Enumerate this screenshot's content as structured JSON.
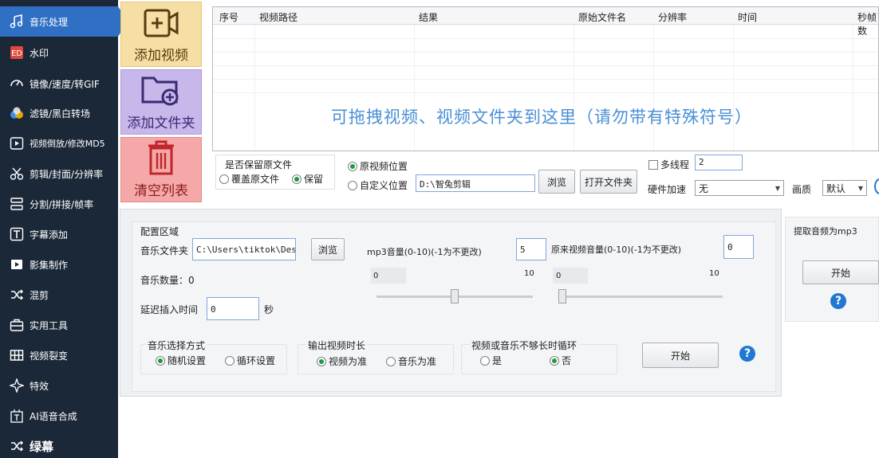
{
  "sidebar": {
    "items": [
      {
        "label": "音乐处理",
        "icon": "music-note-icon"
      },
      {
        "label": "水印",
        "icon": "watermark-icon"
      },
      {
        "label": "镜像/速度/转GIF",
        "icon": "speed-gauge-icon"
      },
      {
        "label": "滤镜/黑白转场",
        "icon": "filter-icon"
      },
      {
        "label": "视频倒放/修改MD5",
        "icon": "rewind-icon"
      },
      {
        "label": "剪辑/封面/分辨率",
        "icon": "scissors-icon"
      },
      {
        "label": "分割/拼接/帧率",
        "icon": "split-icon"
      },
      {
        "label": "字幕添加",
        "icon": "subtitle-icon"
      },
      {
        "label": "影集制作",
        "icon": "album-icon"
      },
      {
        "label": "混剪",
        "icon": "shuffle-icon"
      },
      {
        "label": "实用工具",
        "icon": "toolbox-icon"
      },
      {
        "label": "视频裂变",
        "icon": "grid-icon"
      },
      {
        "label": "特效",
        "icon": "sparkle-icon"
      },
      {
        "label": "AI语音合成",
        "icon": "ai-voice-icon"
      },
      {
        "label": "绿幕",
        "icon": "shuffle-icon"
      }
    ]
  },
  "tiles": {
    "add_video": "添加视频",
    "add_folder": "添加文件夹",
    "clear_list": "清空列表"
  },
  "table": {
    "columns": [
      "序号",
      "视频路径",
      "结果",
      "原始文件名",
      "分辨率",
      "时间",
      "秒帧数"
    ],
    "drop_hint": "可拖拽视频、视频文件夹到这里（请勿带有特殊符号）"
  },
  "keep_original": {
    "title": "是否保留原文件",
    "overwrite_label": "覆盖原文件",
    "keep_label": "保留"
  },
  "output_location": {
    "original_label": "原视频位置",
    "custom_label": "自定义位置",
    "path": "D:\\智兔剪辑",
    "browse_label": "浏览",
    "open_folder_label": "打开文件夹"
  },
  "threading": {
    "multithread_label": "多线程",
    "threads": "2",
    "hw_accel_label": "硬件加速",
    "hw_accel_value": "无",
    "quality_label": "画质",
    "quality_value": "默认"
  },
  "config": {
    "title": "配置区域",
    "music_folder_label": "音乐文件夹",
    "music_folder_value": "C:\\Users\\tiktok\\Deskt",
    "browse_label": "浏览",
    "music_count_label": "音乐数量：0",
    "delay_label": "延迟插入时间",
    "delay_value": "0",
    "delay_unit": "秒",
    "mp3_volume_label": "mp3音量(0-10)(-1为不更改)",
    "mp3_volume_value": "5",
    "mp3_min": "0",
    "mp3_max": "10",
    "mp3_slider_level": 0.5,
    "orig_volume_label": "原来视频音量(0-10)(-1为不更改)",
    "orig_volume_value": "0",
    "orig_min": "0",
    "orig_max": "10",
    "orig_slider_level": 0.0,
    "music_select_title": "音乐选择方式",
    "random_label": "随机设置",
    "loop_label": "循环设置",
    "duration_title": "输出视频时长",
    "video_based_label": "视频为准",
    "music_based_label": "音乐为准",
    "loop_title": "视频或音乐不够长时循环",
    "yes_label": "是",
    "no_label": "否",
    "start_label": "开始"
  },
  "extract": {
    "title": "提取音频为mp3",
    "start_label": "开始"
  },
  "colors": {
    "sidebar_bg": "#1b2838",
    "active": "#2f6fc4",
    "drop_hint": "#4a8fd6",
    "help": "#1f78d1"
  }
}
